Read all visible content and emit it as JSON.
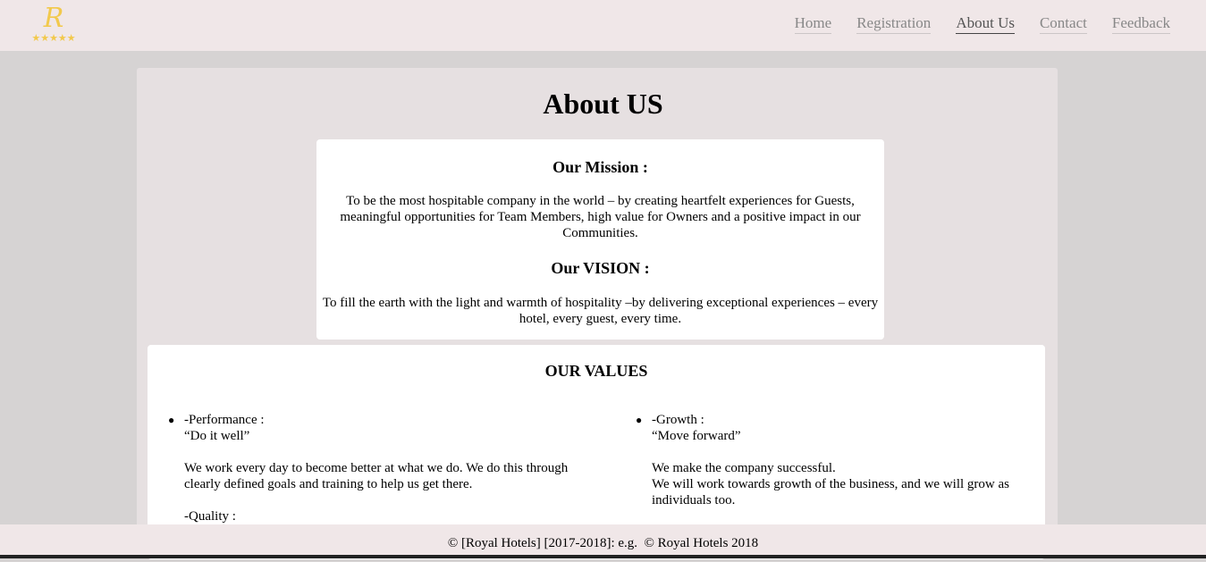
{
  "header": {
    "logo_letter": "R",
    "logo_stars": "★★★★★",
    "nav": [
      {
        "label": "Home",
        "active": false
      },
      {
        "label": "Registration",
        "active": false
      },
      {
        "label": "About Us",
        "active": true
      },
      {
        "label": "Contact",
        "active": false
      },
      {
        "label": "Feedback",
        "active": false
      }
    ]
  },
  "main": {
    "title": "About US",
    "mission": {
      "heading": "Our Mission :",
      "text": "To be the most hospitable company in the world – by creating heartfelt experiences for Guests, meaningful opportunities for Team Members, high value for Owners and a positive impact in our Communities."
    },
    "vision": {
      "heading": "Our VISION :",
      "text": "To fill the earth with the light and warmth of hospitality –by delivering exceptional experiences – every hotel, every guest, every time."
    },
    "values": {
      "heading": "OUR VALUES",
      "items": [
        {
          "name": "-Performance :",
          "motto": "“Do it well”",
          "lines": [
            "We work every day to become better at what we do. We do this through clearly defined goals and training to help us get there."
          ]
        },
        {
          "name": "-Growth :",
          "motto": "“Move forward”",
          "lines": [
            "We make the company successful.",
            "We will work towards growth of the business, and we will grow as individuals too."
          ]
        }
      ],
      "partial_next": "-Quality :"
    }
  },
  "footer": {
    "text": "© [Royal Hotels] [2017-2018]: e.g.  © Royal Hotels 2018"
  },
  "colors": {
    "background": "#d6d3d3",
    "header_bg": "#f0e7e8",
    "panel_bg": "#e6e0e1",
    "card_bg": "#ffffff",
    "logo_gold": "#f2c94c"
  }
}
